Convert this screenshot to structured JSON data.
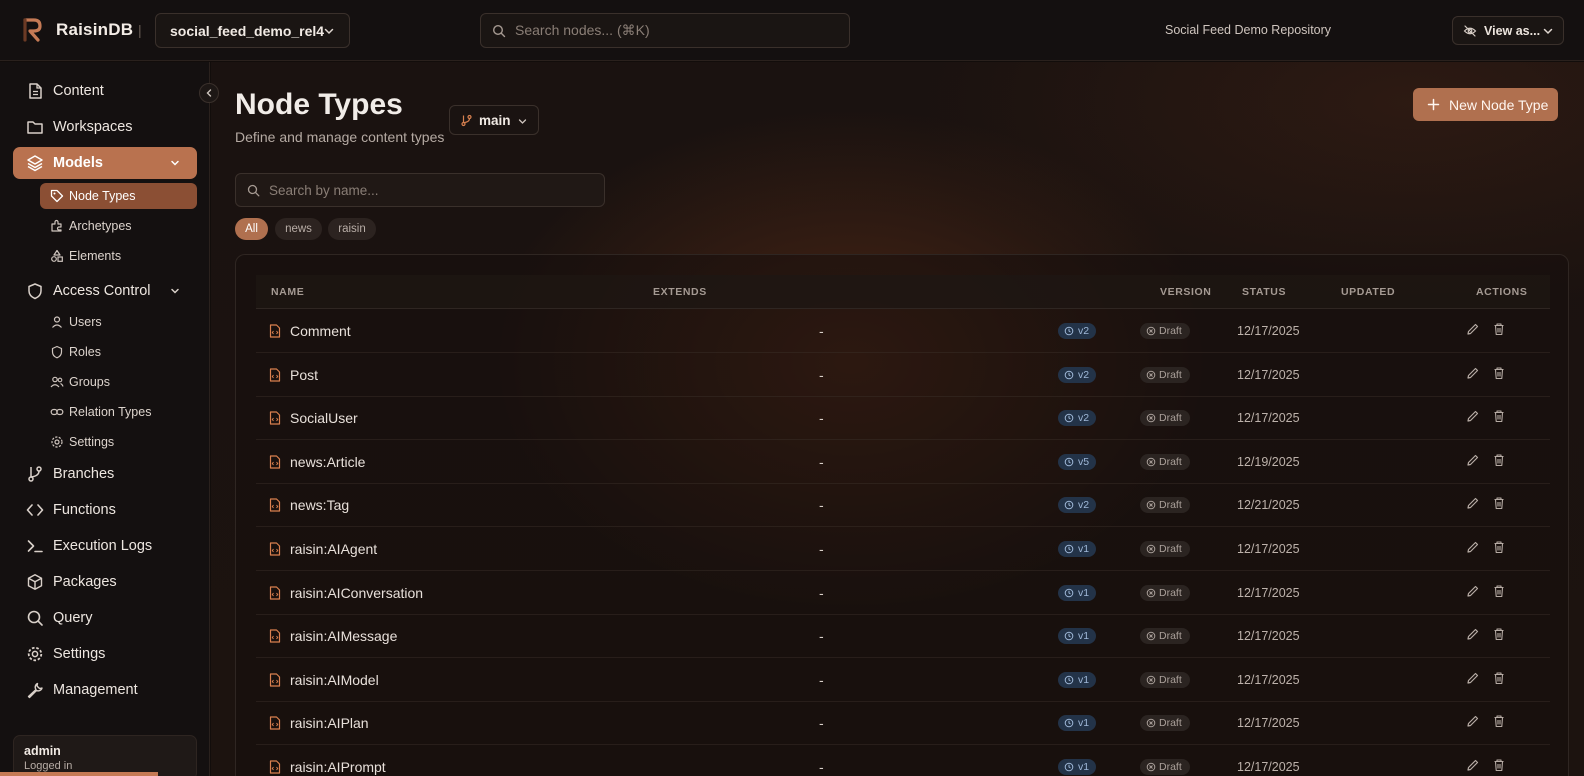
{
  "app": {
    "brand": "RaisinDB",
    "repository_select": "social_feed_demo_rel4",
    "search_placeholder": "Search nodes... (⌘K)",
    "repository_name": "Social Feed Demo Repository",
    "view_as_label": "View as..."
  },
  "sidebar": {
    "items": [
      {
        "label": "Content",
        "icon": "document-icon"
      },
      {
        "label": "Workspaces",
        "icon": "folder-icon"
      },
      {
        "label": "Models",
        "icon": "layers-icon",
        "active": true
      },
      {
        "label": "Access Control",
        "icon": "shield-icon"
      },
      {
        "label": "Branches",
        "icon": "git-branch-icon"
      },
      {
        "label": "Functions",
        "icon": "code-icon"
      },
      {
        "label": "Execution Logs",
        "icon": "terminal-icon"
      },
      {
        "label": "Packages",
        "icon": "package-icon"
      },
      {
        "label": "Query",
        "icon": "search-icon"
      },
      {
        "label": "Settings",
        "icon": "gear-icon"
      },
      {
        "label": "Management",
        "icon": "wrench-icon"
      }
    ],
    "models_sub": [
      {
        "label": "Node Types",
        "active": true
      },
      {
        "label": "Archetypes"
      },
      {
        "label": "Elements"
      }
    ],
    "access_sub": [
      {
        "label": "Users"
      },
      {
        "label": "Roles"
      },
      {
        "label": "Groups"
      },
      {
        "label": "Relation Types"
      },
      {
        "label": "Settings"
      }
    ],
    "user": {
      "name": "admin",
      "status": "Logged in"
    }
  },
  "page": {
    "title": "Node Types",
    "subtitle": "Define and manage content types",
    "branch": "main",
    "new_button": "New Node Type",
    "search_placeholder": "Search by name...",
    "filters": [
      "All",
      "news",
      "raisin"
    ],
    "accent_color": "#b0704f"
  },
  "table": {
    "headers": {
      "name": "NAME",
      "extends": "EXTENDS",
      "version": "VERSION",
      "status": "STATUS",
      "updated": "UPDATED",
      "actions": "ACTIONS"
    },
    "rows": [
      {
        "name": "Comment",
        "extends": "-",
        "version": "v2",
        "status": "Draft",
        "updated": "12/17/2025"
      },
      {
        "name": "Post",
        "extends": "-",
        "version": "v2",
        "status": "Draft",
        "updated": "12/17/2025"
      },
      {
        "name": "SocialUser",
        "extends": "-",
        "version": "v2",
        "status": "Draft",
        "updated": "12/17/2025"
      },
      {
        "name": "news:Article",
        "extends": "-",
        "version": "v5",
        "status": "Draft",
        "updated": "12/19/2025"
      },
      {
        "name": "news:Tag",
        "extends": "-",
        "version": "v2",
        "status": "Draft",
        "updated": "12/21/2025"
      },
      {
        "name": "raisin:AIAgent",
        "extends": "-",
        "version": "v1",
        "status": "Draft",
        "updated": "12/17/2025"
      },
      {
        "name": "raisin:AIConversation",
        "extends": "-",
        "version": "v1",
        "status": "Draft",
        "updated": "12/17/2025"
      },
      {
        "name": "raisin:AIMessage",
        "extends": "-",
        "version": "v1",
        "status": "Draft",
        "updated": "12/17/2025"
      },
      {
        "name": "raisin:AIModel",
        "extends": "-",
        "version": "v1",
        "status": "Draft",
        "updated": "12/17/2025"
      },
      {
        "name": "raisin:AIPlan",
        "extends": "-",
        "version": "v1",
        "status": "Draft",
        "updated": "12/17/2025"
      },
      {
        "name": "raisin:AIPrompt",
        "extends": "-",
        "version": "v1",
        "status": "Draft",
        "updated": "12/17/2025"
      }
    ]
  }
}
